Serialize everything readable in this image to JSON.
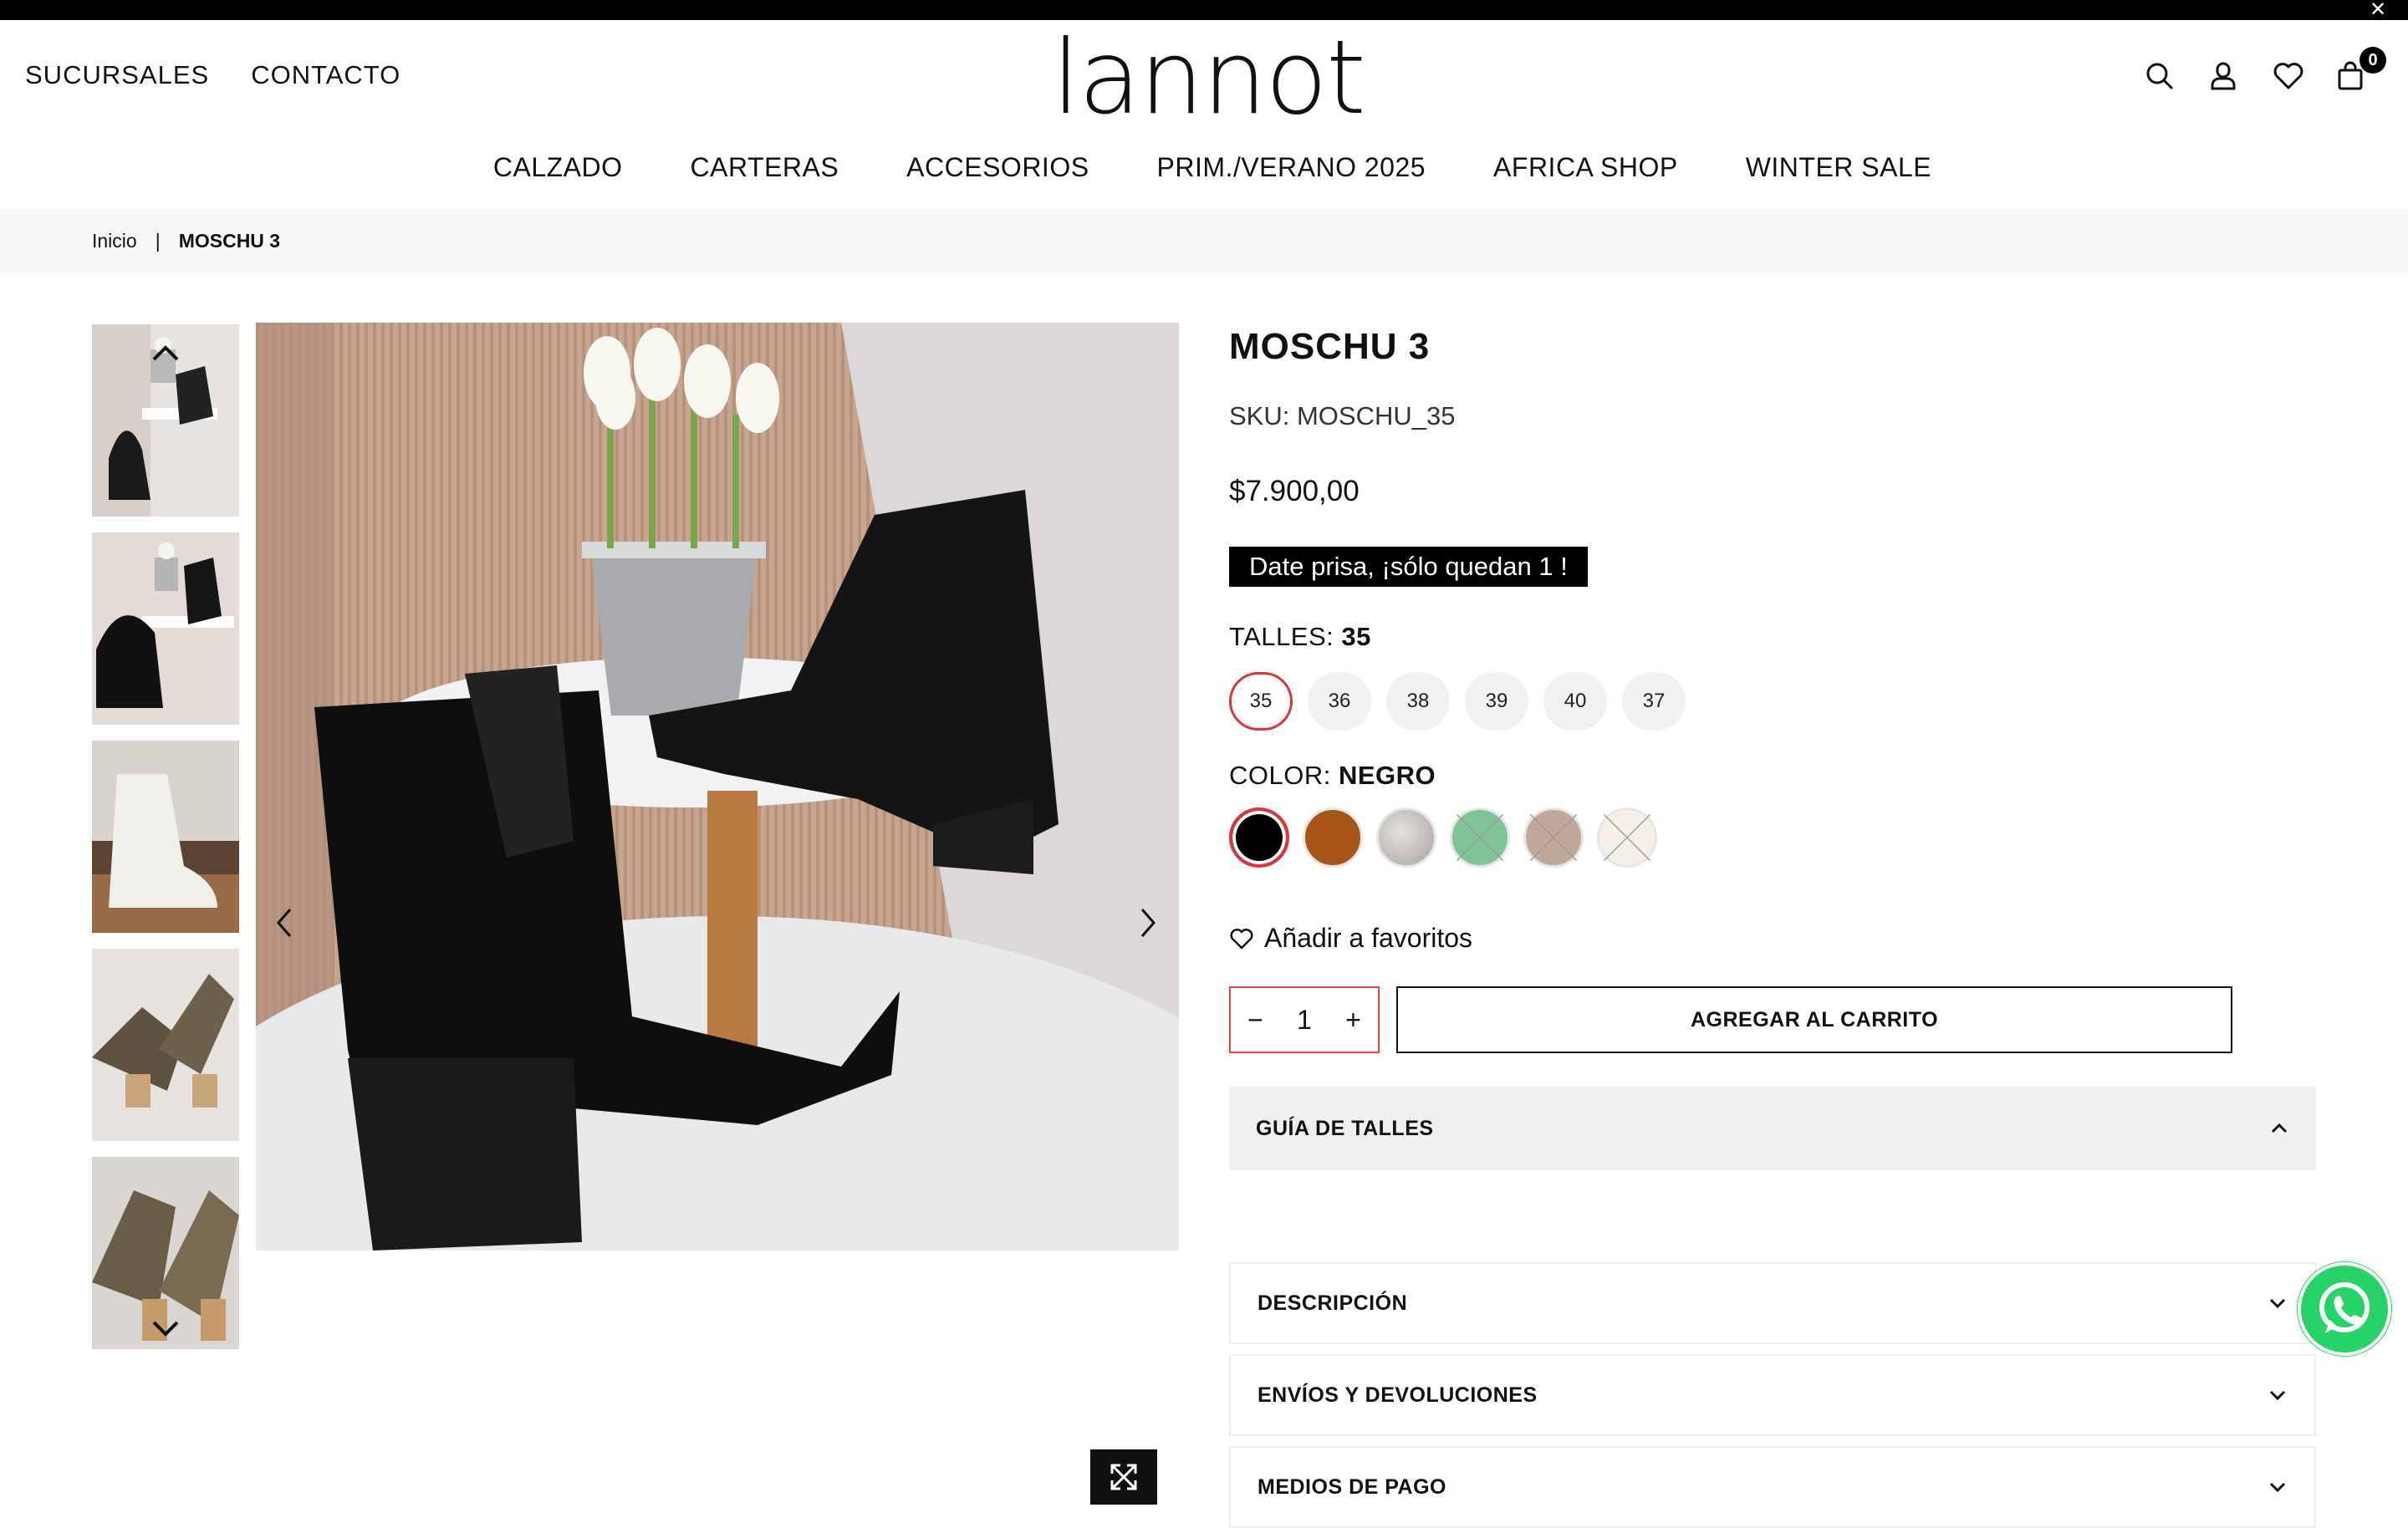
{
  "header": {
    "left_links": [
      "SUCURSALES",
      "CONTACTO"
    ],
    "logo": "lannot",
    "cart_count": "0",
    "icons": [
      "search-icon",
      "user-icon",
      "heart-icon",
      "bag-icon"
    ]
  },
  "nav": [
    "CALZADO",
    "CARTERAS",
    "ACCESORIOS",
    "PRIM./VERANO 2025",
    "AFRICA SHOP",
    "WINTER SALE"
  ],
  "breadcrumb": {
    "home": "Inicio",
    "separator": "|",
    "current": "MOSCHU 3"
  },
  "product": {
    "title": "MOSCHU 3",
    "sku": "SKU: MOSCHU_35",
    "price": "$7.900,00",
    "hurry": "Date prisa, ¡sólo quedan 1 !",
    "size_label": "TALLES:",
    "size_selected": "35",
    "sizes": [
      "35",
      "36",
      "38",
      "39",
      "40",
      "37"
    ],
    "color_label": "COLOR:",
    "color_selected": "NEGRO",
    "colors": [
      {
        "hex": "#000000",
        "available": true,
        "selected": true
      },
      {
        "hex": "#a65418",
        "available": true,
        "selected": false
      },
      {
        "hex": "#c9c6c0",
        "available": true,
        "selected": false
      },
      {
        "hex": "#7fc497",
        "available": false,
        "selected": false
      },
      {
        "hex": "#c0a89a",
        "available": false,
        "selected": false
      },
      {
        "hex": "#f6efe8",
        "available": false,
        "selected": false
      }
    ],
    "favorite": "Añadir a favoritos",
    "quantity": "1",
    "add_to_cart": "AGREGAR AL CARRITO"
  },
  "accordions": {
    "size_guide": "GUÍA DE TALLES",
    "description": "DESCRIPCIÓN",
    "shipping": "ENVÍOS Y DEVOLUCIONES",
    "payment": "MEDIOS DE PAGO"
  },
  "colors": {
    "accent_red": "#d9373f",
    "whatsapp": "#25d366"
  }
}
